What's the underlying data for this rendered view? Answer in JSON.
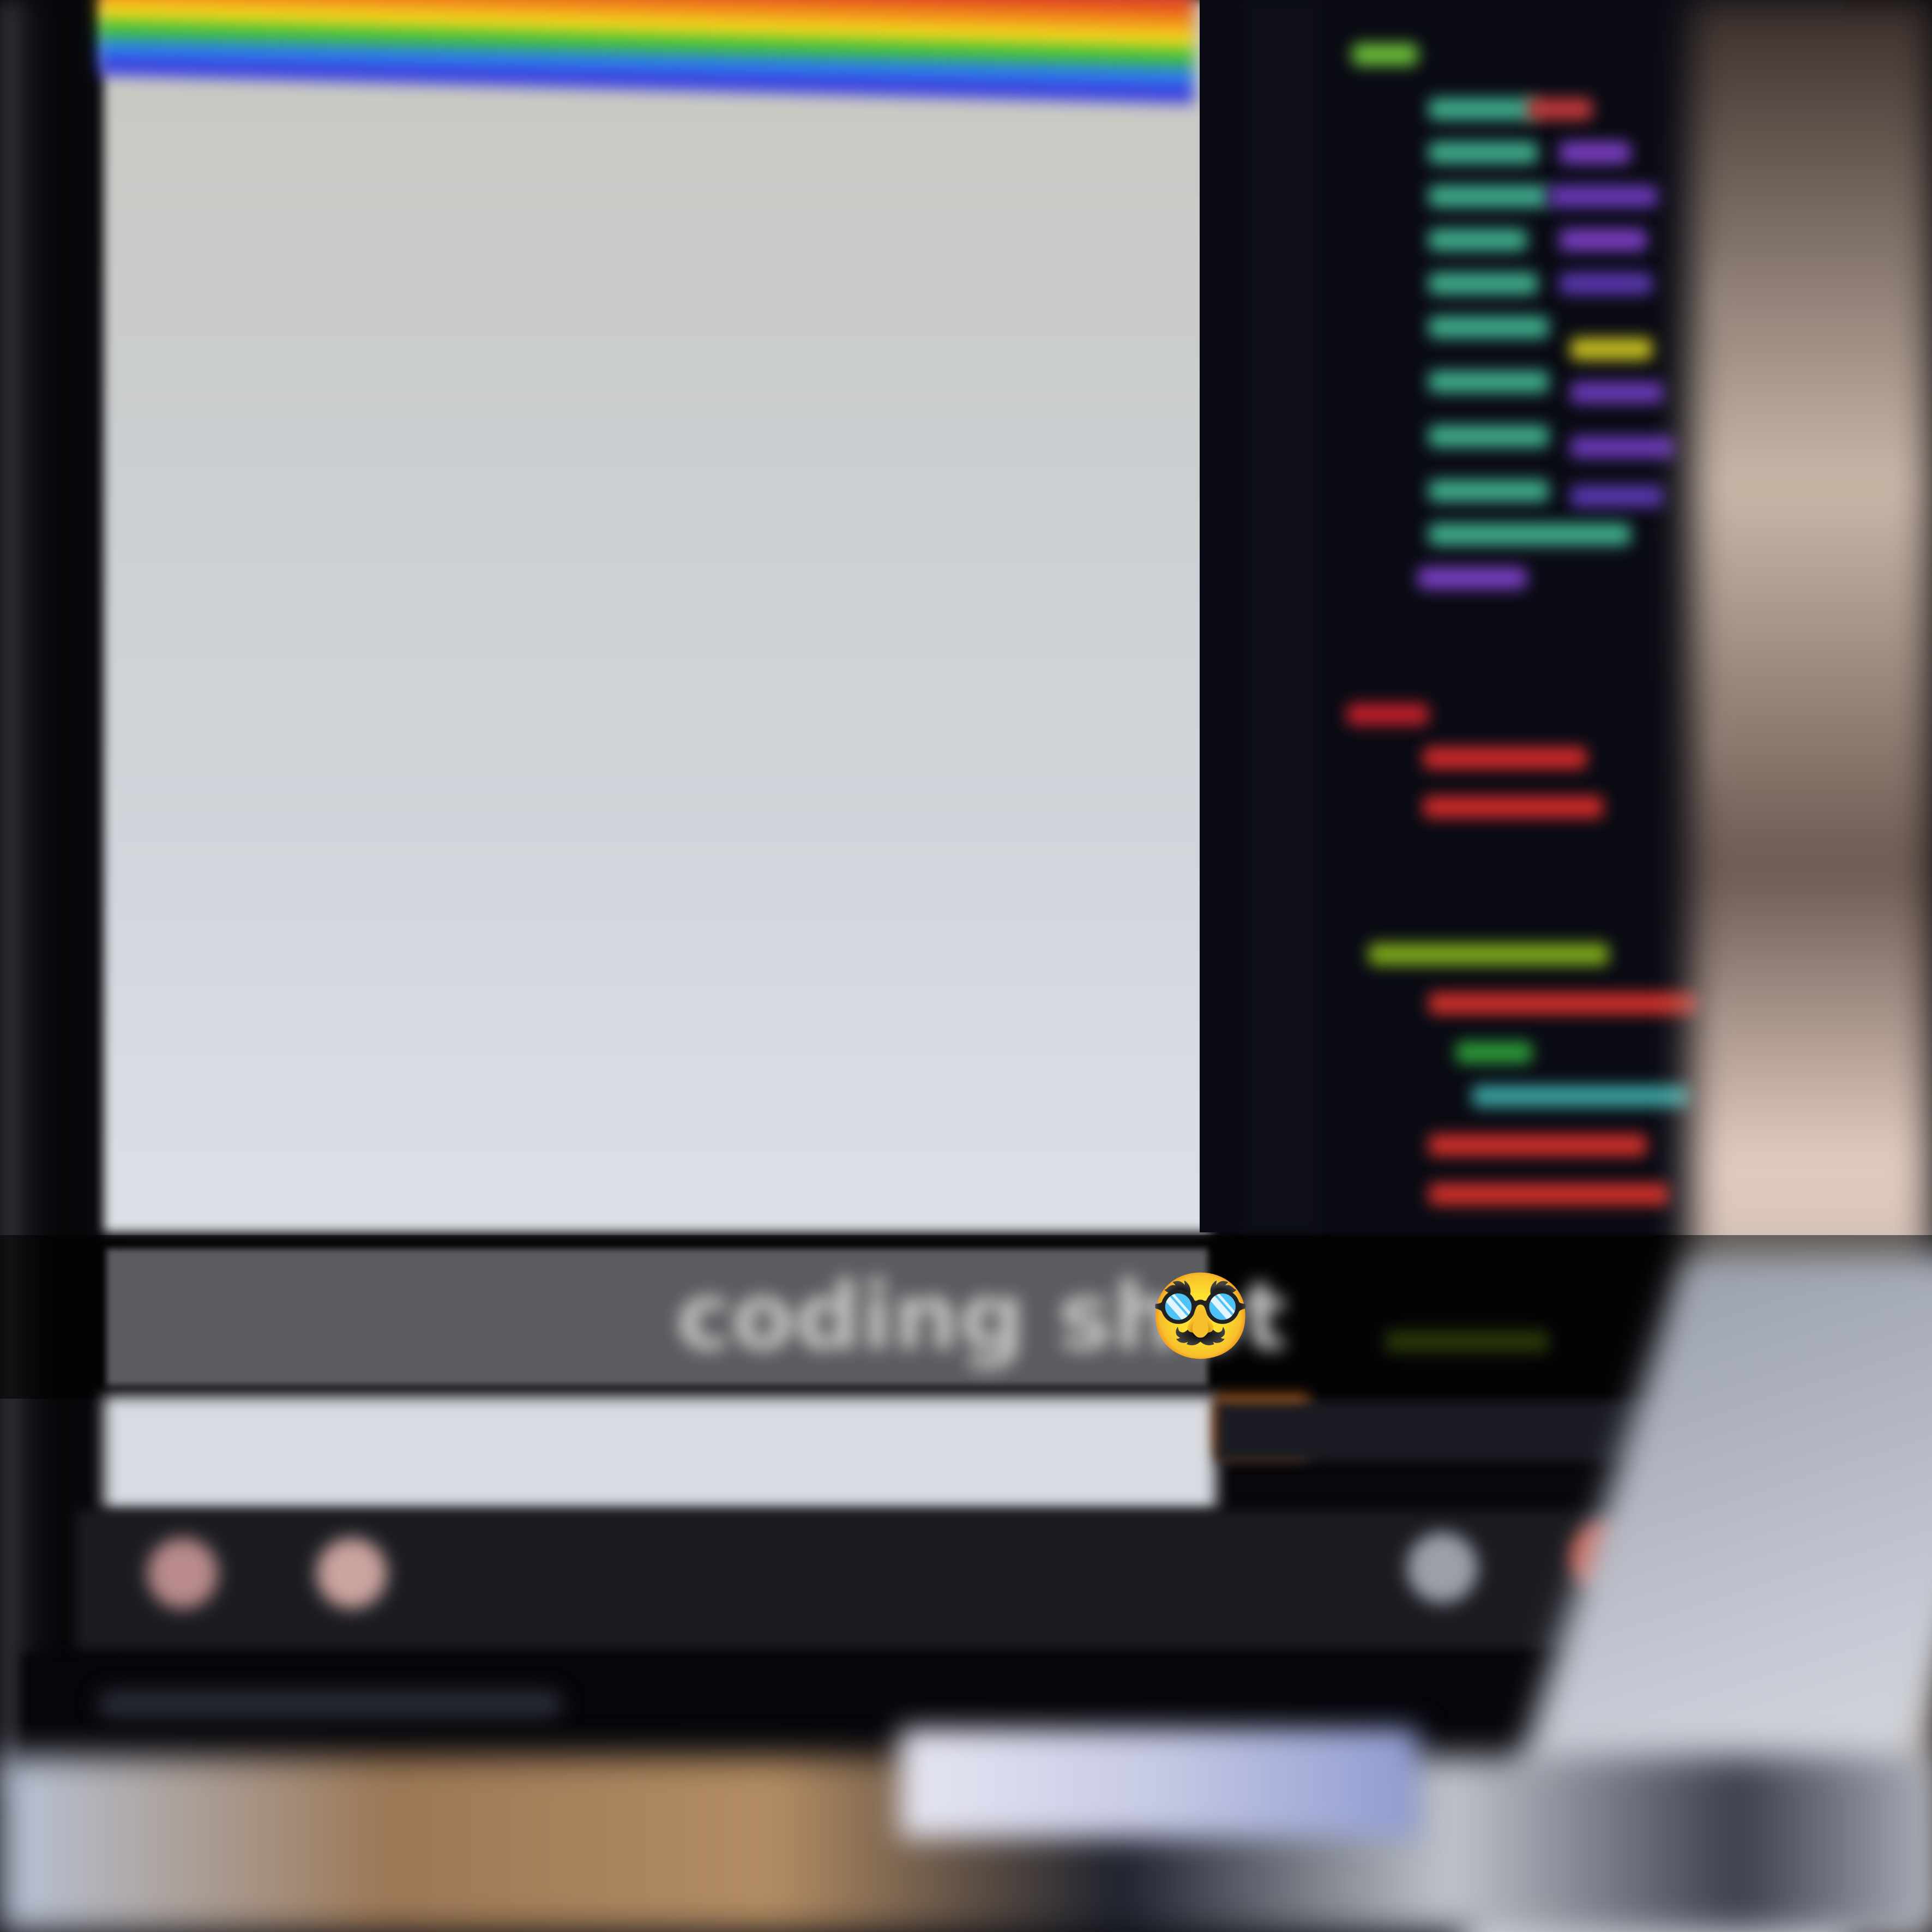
{
  "caption": {
    "text": "coding shot",
    "emoji": "🥸",
    "emoji_icon": "disguised-face-icon"
  },
  "colors": {
    "caption_band": "#5a5c5f",
    "caption_text": "#c9c9c9",
    "editor_background": "#0a0b14",
    "browser_panel": "#d2d6dc",
    "status_accent": "#c8691f"
  },
  "rainbow_colors": [
    "#e0411f",
    "#f08a1c",
    "#f2d51b",
    "#42c23a",
    "#2b7fe8",
    "#3b3fe0"
  ]
}
